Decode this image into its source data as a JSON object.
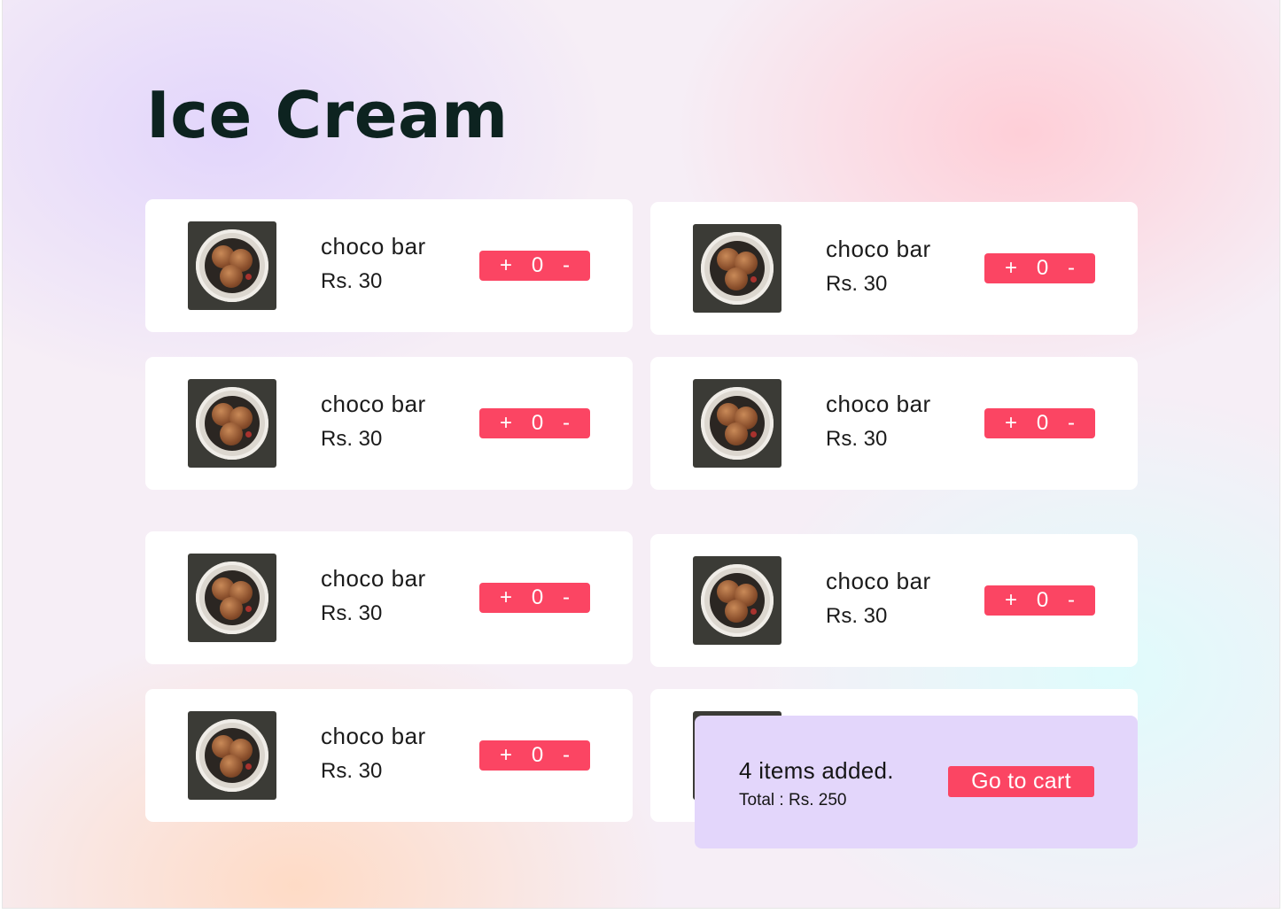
{
  "page": {
    "title": "Ice Cream"
  },
  "products": [
    {
      "name": "choco bar",
      "price": "Rs. 30",
      "plus": "+",
      "qty": "0",
      "minus": "-"
    },
    {
      "name": "choco bar",
      "price": "Rs. 30",
      "plus": "+",
      "qty": "0",
      "minus": "-"
    },
    {
      "name": "choco bar",
      "price": "Rs. 30",
      "plus": "+",
      "qty": "0",
      "minus": "-"
    },
    {
      "name": "choco bar",
      "price": "Rs. 30",
      "plus": "+",
      "qty": "0",
      "minus": "-"
    },
    {
      "name": "choco bar",
      "price": "Rs. 30",
      "plus": "+",
      "qty": "0",
      "minus": "-"
    },
    {
      "name": "choco bar",
      "price": "Rs. 30",
      "plus": "+",
      "qty": "0",
      "minus": "-"
    },
    {
      "name": "choco bar",
      "price": "Rs. 30",
      "plus": "+",
      "qty": "0",
      "minus": "-"
    }
  ],
  "cart": {
    "summary": "4 items added.",
    "total": "Total : Rs. 250",
    "button_label": "Go to cart"
  },
  "colors": {
    "accent": "#fb4563",
    "title": "#0d2320",
    "cart_panel": "#e3d6fb"
  }
}
